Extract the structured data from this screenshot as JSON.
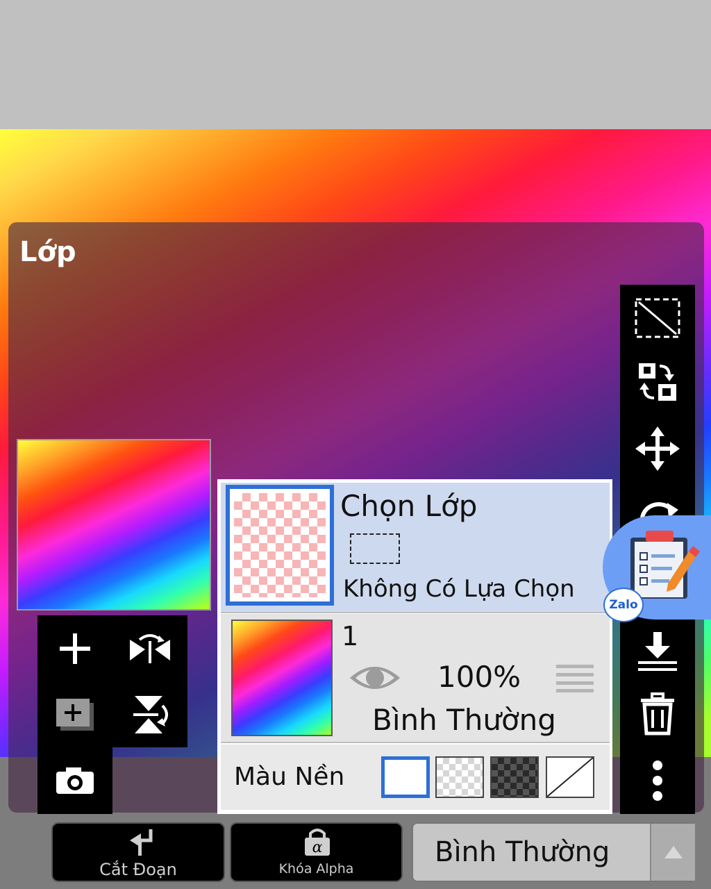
{
  "panel": {
    "title": "Lớp"
  },
  "selection_row": {
    "title": "Chọn Lớp",
    "status": "Không Có Lựa Chọn"
  },
  "layer": {
    "name": "1",
    "opacity": "100%",
    "blend_mode": "Bình Thường",
    "visible": true
  },
  "background": {
    "label": "Màu Nền",
    "options": [
      "white",
      "light-checker",
      "dark-checker",
      "none"
    ],
    "selected": "white"
  },
  "bottom": {
    "clip_label": "Cắt Đoạn",
    "alpha_lock_label": "Khóa Alpha",
    "blend_mode_label": "Bình Thường"
  },
  "zalo": {
    "badge": "Zalo"
  },
  "colors": {
    "accent": "#2d6fd6",
    "selected_row": "#cdd9ee",
    "toolbar": "#000000",
    "zalo_bubble": "#6c9ef5"
  },
  "icons": {
    "right_toolbar": [
      "select-all-icon",
      "swap-layers-icon",
      "move-icon",
      "rotate-icon",
      "merge-down-icon",
      "trash-icon",
      "more-icon"
    ],
    "left_toolbar": [
      "add-layer-icon",
      "flip-horizontal-icon",
      "duplicate-layer-icon",
      "flip-vertical-icon",
      "camera-icon"
    ]
  }
}
